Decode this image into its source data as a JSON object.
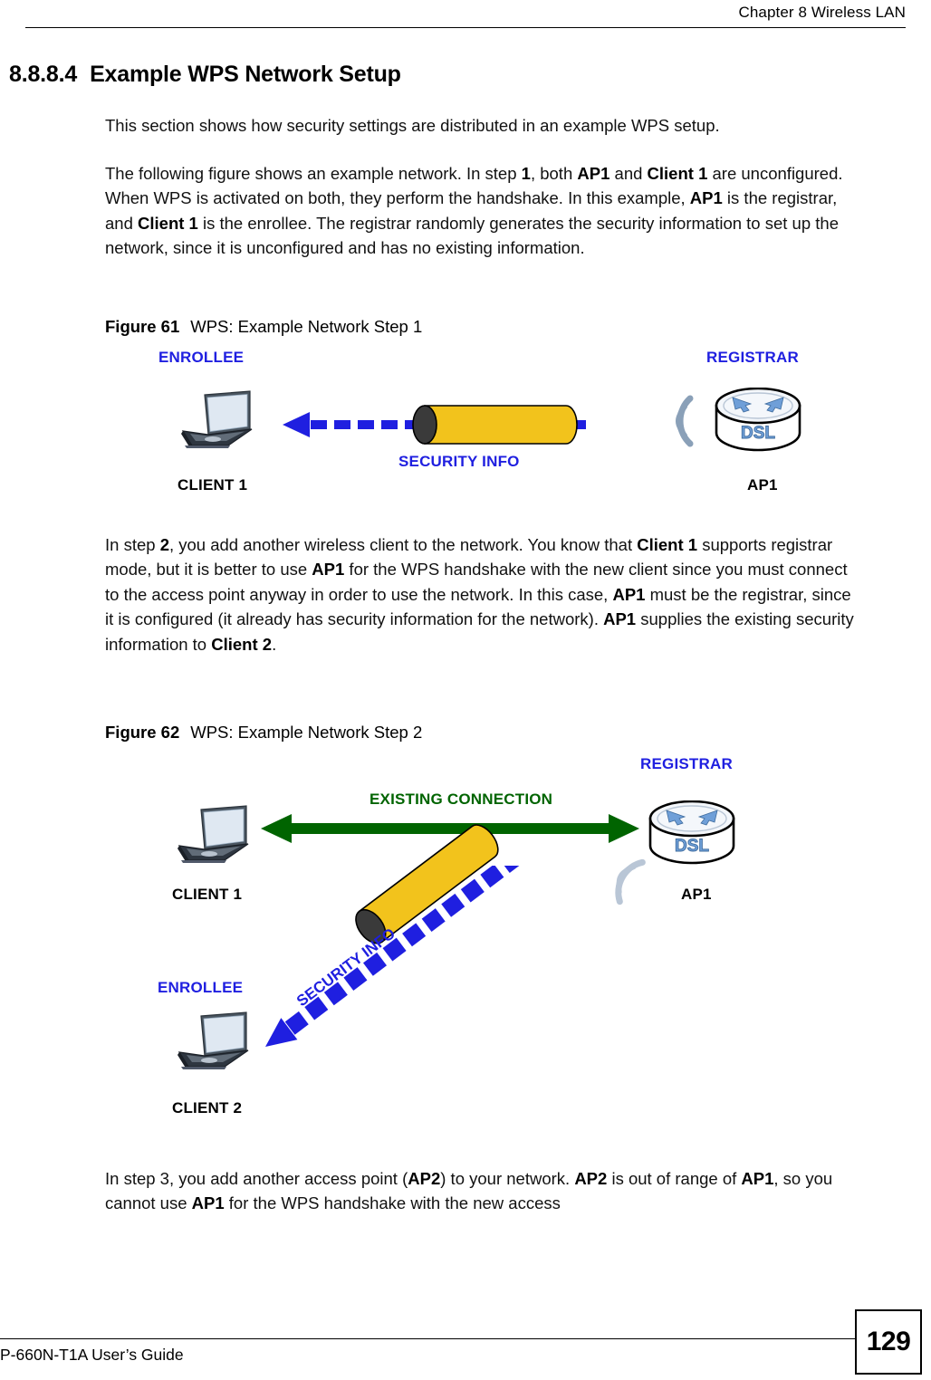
{
  "header": {
    "chapter_title": "Chapter 8 Wireless LAN"
  },
  "section": {
    "number": "8.8.8.4",
    "title": "Example WPS Network Setup"
  },
  "paragraphs": {
    "intro": "This section shows how security settings are distributed in an example WPS setup.",
    "step1_a": "The following figure shows an example network. In step ",
    "step1_b": "1",
    "step1_c": ", both ",
    "step1_d": "AP1",
    "step1_e": " and ",
    "step1_f": "Client 1",
    "step1_g": " are unconfigured. When WPS is activated on both, they perform the handshake. In this example, ",
    "step1_h": "AP1",
    "step1_i": " is the registrar, and ",
    "step1_j": "Client 1",
    "step1_k": " is the enrollee. The registrar randomly generates the security information to set up the network, since it is unconfigured and has no existing information.",
    "step2_a": "In step ",
    "step2_b": "2",
    "step2_c": ", you add another wireless client to the network. You know that ",
    "step2_d": "Client 1",
    "step2_e": " supports registrar mode, but it is better to use ",
    "step2_f": "AP1",
    "step2_g": " for the WPS handshake with the new client since you must connect to the access point anyway in order to use the network. In this case, ",
    "step2_h": "AP1",
    "step2_i": " must be the registrar, since it is configured (it already has security information for the network). ",
    "step2_j": "AP1",
    "step2_k": " supplies the existing security information to ",
    "step2_l": "Client 2",
    "step2_m": ".",
    "step3_a": "In step 3, you add another access point (",
    "step3_b": "AP2",
    "step3_c": ") to your network. ",
    "step3_d": "AP2",
    "step3_e": " is out of range of ",
    "step3_f": "AP1",
    "step3_g": ", so you cannot use ",
    "step3_h": "AP1",
    "step3_i": " for the WPS handshake with the new access"
  },
  "figure61": {
    "caption_label": "Figure 61",
    "caption_text": "WPS: Example Network Step 1",
    "enrollee_label": "ENROLLEE",
    "registrar_label": "REGISTRAR",
    "client_label": "CLIENT 1",
    "ap_label": "AP1",
    "security_info_label": "SECURITY INFO",
    "router_badge": "DSL"
  },
  "figure62": {
    "caption_label": "Figure 62",
    "caption_text": "WPS: Example Network Step 2",
    "registrar_label": "REGISTRAR",
    "existing_connection_label": "EXISTING CONNECTION",
    "client1_label": "CLIENT 1",
    "ap_label": "AP1",
    "enrollee_label": "ENROLLEE",
    "client2_label": "CLIENT 2",
    "security_info_label": "SECURITY INFO",
    "router_badge": "DSL"
  },
  "footer": {
    "guide_title": "P-660N-T1A User’s Guide",
    "page_number": "129"
  },
  "colors": {
    "arrow_blue": "#1f1fe0",
    "cylinder_yellow": "#f2c31c",
    "cylinder_cap": "#3a3a3a",
    "green": "#006400",
    "router_blue": "#6f9fd8",
    "text_black": "#000000"
  }
}
